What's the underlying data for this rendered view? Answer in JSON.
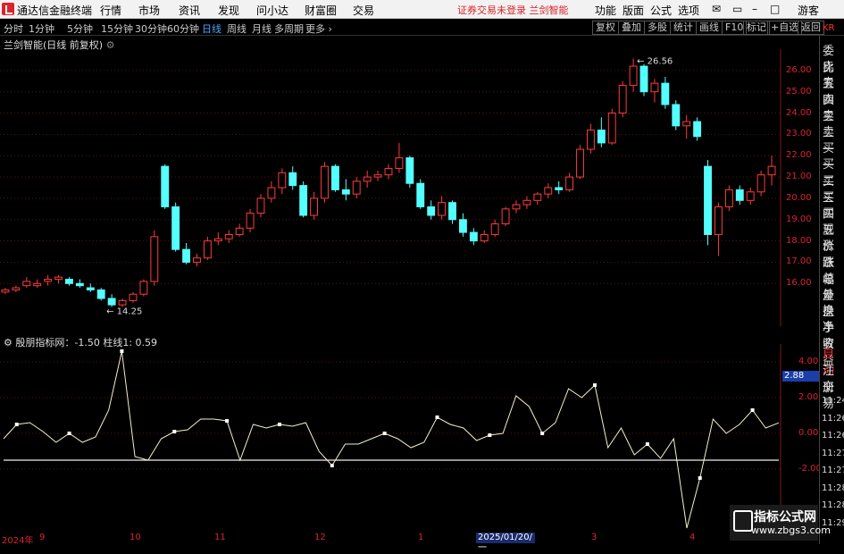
{
  "app": {
    "title": "通达信金融终端"
  },
  "menu": [
    "行情",
    "市场",
    "资讯",
    "发现",
    "问小达",
    "财富圈",
    "交易"
  ],
  "status_text": "证券交易未登录",
  "stock_name": "兰剑智能",
  "top_right": [
    "功能",
    "版面",
    "公式",
    "选项"
  ],
  "user": "游客",
  "periods": [
    "分时",
    "1分钟",
    "5分钟",
    "15分钟",
    "30分钟",
    "60分钟",
    "日线",
    "周线",
    "月线",
    "多周期",
    "更多"
  ],
  "active_period": "日线",
  "tools": [
    "复权",
    "叠加",
    "多股",
    "统计",
    "画线",
    "F10",
    "标记",
    "+自选",
    "返回"
  ],
  "chart": {
    "title": "兰剑智能(日线 前复权)",
    "high_label": "26.56",
    "low_label": "14.25"
  },
  "price_axis": [
    "26.00",
    "25.00",
    "24.00",
    "23.00",
    "22.00",
    "21.00",
    "20.00",
    "19.00",
    "18.00",
    "17.00",
    "16.00"
  ],
  "indicator": {
    "title": "殷朋指标网：-1.50  柱线1: 0.59",
    "axis": [
      "4.00",
      "2.00",
      "0.00",
      "-2.00"
    ],
    "current": "2.88"
  },
  "right_panel": [
    "委比",
    "卖五",
    "卖四",
    "卖三",
    "卖二",
    "卖一",
    "买一",
    "买二",
    "买三",
    "买四",
    "买五",
    "现价",
    "涨跌",
    "涨幅",
    "总量",
    "外盘",
    "换手",
    "净资",
    "收益"
  ],
  "right_panel_code": "KR",
  "right_panel2": [
    "自动",
    "注册",
    "交易"
  ],
  "times": [
    "11:24",
    "11:26",
    "11:26",
    "11:27",
    "11:27",
    "11:28",
    "11:28",
    "11:29"
  ],
  "x_axis": [
    "2024年",
    "9",
    "10",
    "11",
    "12",
    "1",
    "2025/01/20/一",
    "3",
    "4"
  ],
  "watermark": {
    "title": "指标公式网",
    "url": "www.zbgs3.com"
  },
  "colors": {
    "up": "#ff3b3b",
    "down": "#54ffff",
    "grid": "#7a1a1a",
    "bg": "#000000"
  },
  "chart_data": {
    "type": "line",
    "candles": [
      [
        15.6,
        15.8,
        15.5,
        15.7
      ],
      [
        15.7,
        15.9,
        15.6,
        15.8
      ],
      [
        15.9,
        16.3,
        15.8,
        16.1
      ],
      [
        15.9,
        16.2,
        15.8,
        16.0
      ],
      [
        16.1,
        16.4,
        15.9,
        16.2
      ],
      [
        16.2,
        16.4,
        16.0,
        16.3
      ],
      [
        16.2,
        16.3,
        15.9,
        16.0
      ],
      [
        16.0,
        16.2,
        15.8,
        15.9
      ],
      [
        15.8,
        16.0,
        15.6,
        15.7
      ],
      [
        15.7,
        15.8,
        15.2,
        15.3
      ],
      [
        15.3,
        15.5,
        14.9,
        15.0
      ],
      [
        15.0,
        15.3,
        14.9,
        15.2
      ],
      [
        15.2,
        15.6,
        15.1,
        15.5
      ],
      [
        15.5,
        16.2,
        15.4,
        16.1
      ],
      [
        16.1,
        18.5,
        15.9,
        18.2
      ],
      [
        21.5,
        21.6,
        19.5,
        19.6
      ],
      [
        19.6,
        19.8,
        17.5,
        17.6
      ],
      [
        17.6,
        17.9,
        16.9,
        17.0
      ],
      [
        17.0,
        17.4,
        16.8,
        17.2
      ],
      [
        17.2,
        18.2,
        17.1,
        18.0
      ],
      [
        18.0,
        18.4,
        17.8,
        18.1
      ],
      [
        18.1,
        18.5,
        17.9,
        18.3
      ],
      [
        18.3,
        18.8,
        18.2,
        18.6
      ],
      [
        18.6,
        19.5,
        18.4,
        19.3
      ],
      [
        19.3,
        20.2,
        19.1,
        20.0
      ],
      [
        20.0,
        20.8,
        19.8,
        20.5
      ],
      [
        20.5,
        21.4,
        20.2,
        21.2
      ],
      [
        21.2,
        21.5,
        20.4,
        20.6
      ],
      [
        20.6,
        20.8,
        19.1,
        19.2
      ],
      [
        19.2,
        20.3,
        19.0,
        20.0
      ],
      [
        20.0,
        21.7,
        19.8,
        21.5
      ],
      [
        21.5,
        21.6,
        20.3,
        20.4
      ],
      [
        20.4,
        20.9,
        19.9,
        20.2
      ],
      [
        20.2,
        21.0,
        20.0,
        20.8
      ],
      [
        20.8,
        21.3,
        20.5,
        21.0
      ],
      [
        21.0,
        21.3,
        20.8,
        21.1
      ],
      [
        21.1,
        21.6,
        20.9,
        21.4
      ],
      [
        21.4,
        22.6,
        21.2,
        21.9
      ],
      [
        21.9,
        22.0,
        20.5,
        20.7
      ],
      [
        20.7,
        20.9,
        19.5,
        19.6
      ],
      [
        19.6,
        19.9,
        19.0,
        19.2
      ],
      [
        19.2,
        20.1,
        19.0,
        19.8
      ],
      [
        19.8,
        19.9,
        18.8,
        19.0
      ],
      [
        19.0,
        19.3,
        18.2,
        18.4
      ],
      [
        18.4,
        18.6,
        17.8,
        18.0
      ],
      [
        18.0,
        18.5,
        17.9,
        18.3
      ],
      [
        18.3,
        19.0,
        18.2,
        18.8
      ],
      [
        18.8,
        19.6,
        18.7,
        19.5
      ],
      [
        19.5,
        19.9,
        19.3,
        19.7
      ],
      [
        19.7,
        20.1,
        19.5,
        19.9
      ],
      [
        19.9,
        20.3,
        19.7,
        20.2
      ],
      [
        20.2,
        20.7,
        20.0,
        20.5
      ],
      [
        20.5,
        20.8,
        20.2,
        20.4
      ],
      [
        20.4,
        21.2,
        20.3,
        21.0
      ],
      [
        21.0,
        22.5,
        20.9,
        22.3
      ],
      [
        22.3,
        23.5,
        22.1,
        23.2
      ],
      [
        23.2,
        23.8,
        22.4,
        22.6
      ],
      [
        22.6,
        24.2,
        22.5,
        24.0
      ],
      [
        24.0,
        25.5,
        23.8,
        25.3
      ],
      [
        25.3,
        26.56,
        25.0,
        26.2
      ],
      [
        26.2,
        26.3,
        24.8,
        25.0
      ],
      [
        25.0,
        25.6,
        24.5,
        25.4
      ],
      [
        25.4,
        25.7,
        24.2,
        24.4
      ],
      [
        24.4,
        24.6,
        23.2,
        23.4
      ],
      [
        23.4,
        23.9,
        22.8,
        23.6
      ],
      [
        23.6,
        23.8,
        22.7,
        22.9
      ],
      [
        21.5,
        21.8,
        17.8,
        18.3
      ],
      [
        18.3,
        19.8,
        17.3,
        19.6
      ],
      [
        19.6,
        20.6,
        19.4,
        20.4
      ],
      [
        20.4,
        20.6,
        19.7,
        19.9
      ],
      [
        19.9,
        20.5,
        19.7,
        20.3
      ],
      [
        20.3,
        21.3,
        20.1,
        21.1
      ],
      [
        21.1,
        22.0,
        20.6,
        21.5
      ]
    ],
    "indicator": [
      -0.3,
      0.5,
      0.6,
      0.1,
      -0.5,
      0.0,
      -0.5,
      -0.2,
      1.3,
      4.6,
      -1.3,
      -1.5,
      -0.3,
      0.1,
      0.2,
      0.8,
      0.8,
      0.7,
      -1.5,
      0.5,
      0.3,
      0.5,
      0.4,
      0.6,
      -1.0,
      -1.8,
      -0.6,
      -0.6,
      -0.3,
      0.0,
      -0.3,
      -0.8,
      -0.5,
      0.9,
      0.5,
      0.3,
      -0.4,
      -0.1,
      0.0,
      2.1,
      1.5,
      0.0,
      0.6,
      2.5,
      2.0,
      2.7,
      -0.8,
      0.3,
      -1.2,
      -0.6,
      -1.4,
      -0.3,
      -5.3,
      -2.5,
      0.8,
      0.0,
      0.5,
      1.3,
      0.3,
      0.59
    ],
    "ylim": [
      14,
      27
    ]
  }
}
